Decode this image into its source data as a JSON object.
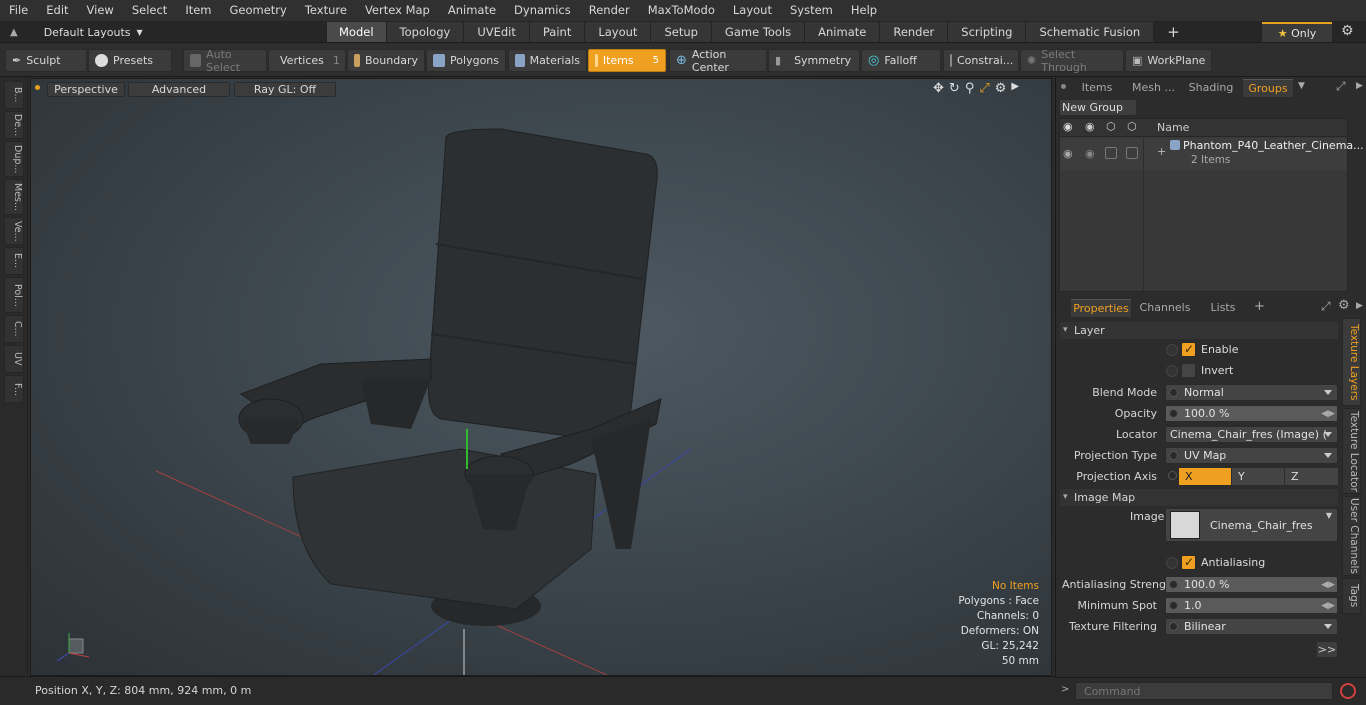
{
  "menubar": {
    "items": [
      "File",
      "Edit",
      "View",
      "Select",
      "Item",
      "Geometry",
      "Texture",
      "Vertex Map",
      "Animate",
      "Dynamics",
      "Render",
      "MaxToModo",
      "Layout",
      "System",
      "Help"
    ]
  },
  "layout_selector": {
    "label": "Default Layouts"
  },
  "mode_tabs": [
    {
      "label": "Model",
      "active": true
    },
    {
      "label": "Topology"
    },
    {
      "label": "UVEdit"
    },
    {
      "label": "Paint"
    },
    {
      "label": "Layout"
    },
    {
      "label": "Setup"
    },
    {
      "label": "Game Tools"
    },
    {
      "label": "Animate"
    },
    {
      "label": "Render"
    },
    {
      "label": "Scripting"
    },
    {
      "label": "Schematic Fusion"
    }
  ],
  "only_button": "Only",
  "toolbar": {
    "sculpt": "Sculpt",
    "presets": "Presets",
    "auto_select": "Auto Select",
    "vertices": "Vertices",
    "vertices_count": "1",
    "boundary": "Boundary",
    "polygons": "Polygons",
    "materials": "Materials",
    "items": "Items",
    "items_count": "5",
    "action_center": "Action Center",
    "symmetry": "Symmetry",
    "falloff": "Falloff",
    "constraints": "Constrai...",
    "select_through": "Select Through",
    "workplane": "WorkPlane"
  },
  "left_tabs": [
    "B...",
    "De...",
    "Dup...",
    "Mes...",
    "Ve...",
    "E...",
    "Pol...",
    "C...",
    "UV",
    "F..."
  ],
  "viewport": {
    "perspective": "Perspective",
    "advanced": "Advanced",
    "raygl": "Ray GL: Off",
    "stats": {
      "selection": "No Items",
      "polygons": "Polygons : Face",
      "channels": "Channels: 0",
      "deformers": "Deformers: ON",
      "gl": "GL: 25,242",
      "scale": "50 mm"
    }
  },
  "statusbar": {
    "position": "Position X, Y, Z:  804 mm, 924 mm, 0 m"
  },
  "groups_panel": {
    "tabs": [
      "Items",
      "Mesh ...",
      "Shading",
      "Groups"
    ],
    "new_group": "New Group",
    "col_name": "Name",
    "group_name": "Phantom_P40_Leather_Cinema...",
    "group_count": "2 Items"
  },
  "properties_panel": {
    "tabs": [
      "Properties",
      "Channels",
      "Lists"
    ],
    "section_layer": "Layer",
    "enable": "Enable",
    "invert": "Invert",
    "blend_mode_label": "Blend Mode",
    "blend_mode": "Normal",
    "opacity_label": "Opacity",
    "opacity": "100.0 %",
    "locator_label": "Locator",
    "locator": "Cinema_Chair_fres (Image) ( ...",
    "projection_type_label": "Projection Type",
    "projection_type": "UV Map",
    "projection_axis_label": "Projection Axis",
    "axis_x": "X",
    "axis_y": "Y",
    "axis_z": "Z",
    "section_image_map": "Image Map",
    "image_label": "Image",
    "image": "Cinema_Chair_fres",
    "antialiasing": "Antialiasing",
    "aa_strength_label": "Antialiasing Strength",
    "aa_strength": "100.0 %",
    "min_spot_label": "Minimum Spot",
    "min_spot": "1.0",
    "tex_filter_label": "Texture Filtering",
    "tex_filter": "Bilinear",
    "more": ">>"
  },
  "side_vtabs": [
    "Texture Layers",
    "Texture Locator",
    "User Channels",
    "Tags"
  ],
  "command": {
    "placeholder": "Command"
  },
  "colors": {
    "accent": "#f0a020",
    "viewport_bg": "#3f4950"
  }
}
